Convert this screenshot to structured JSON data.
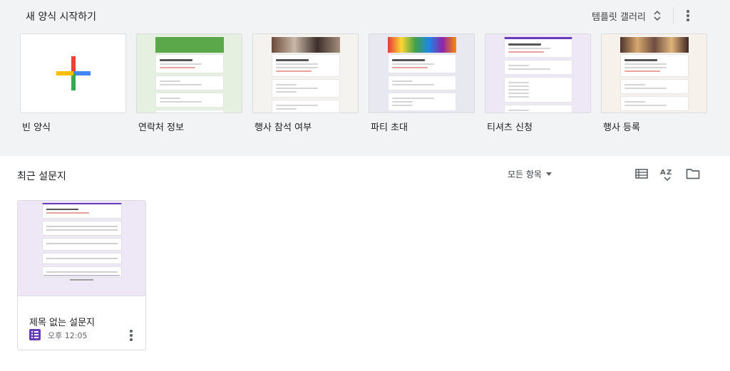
{
  "templates_section": {
    "title": "새 양식 시작하기",
    "gallery_label": "템플릿 갤러리",
    "icons": {
      "gallery_toggle": "unfold-more-icon",
      "more": "more-vert-icon"
    },
    "items": [
      {
        "label": "빈 양식"
      },
      {
        "label": "연락처 정보"
      },
      {
        "label": "행사 참석 여부"
      },
      {
        "label": "파티 초대"
      },
      {
        "label": "티셔츠 신청"
      },
      {
        "label": "행사 등록"
      }
    ]
  },
  "recent_section": {
    "title": "최근 설문지",
    "owner_filter": "모든 항목",
    "icons": {
      "list_view": "list-view-icon",
      "sort": "sort-az-icon",
      "folder": "folder-icon"
    },
    "documents": [
      {
        "title": "제목 없는 설문지",
        "time": "오후 12:05",
        "icon": "google-forms-icon"
      }
    ]
  },
  "colors": {
    "forms_purple": "#673ab7",
    "section_bg": "#f1f3f4",
    "preview_bg": "#ede7f6"
  }
}
